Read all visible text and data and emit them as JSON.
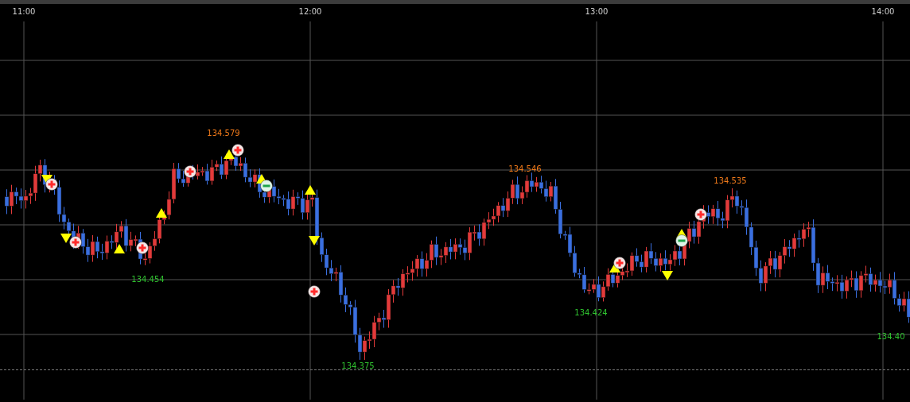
{
  "time_axis": [
    {
      "label": "11:00"
    },
    {
      "label": "12:00"
    },
    {
      "label": "13:00"
    },
    {
      "label": "14:00"
    }
  ],
  "price_labels": [
    {
      "text": "134.579",
      "kind": "high"
    },
    {
      "text": "134.454",
      "kind": "low"
    },
    {
      "text": "134.375",
      "kind": "low"
    },
    {
      "text": "134.546",
      "kind": "high"
    },
    {
      "text": "134.424",
      "kind": "low"
    },
    {
      "text": "134.535",
      "kind": "high"
    },
    {
      "text": "134.40",
      "kind": "low"
    }
  ]
}
